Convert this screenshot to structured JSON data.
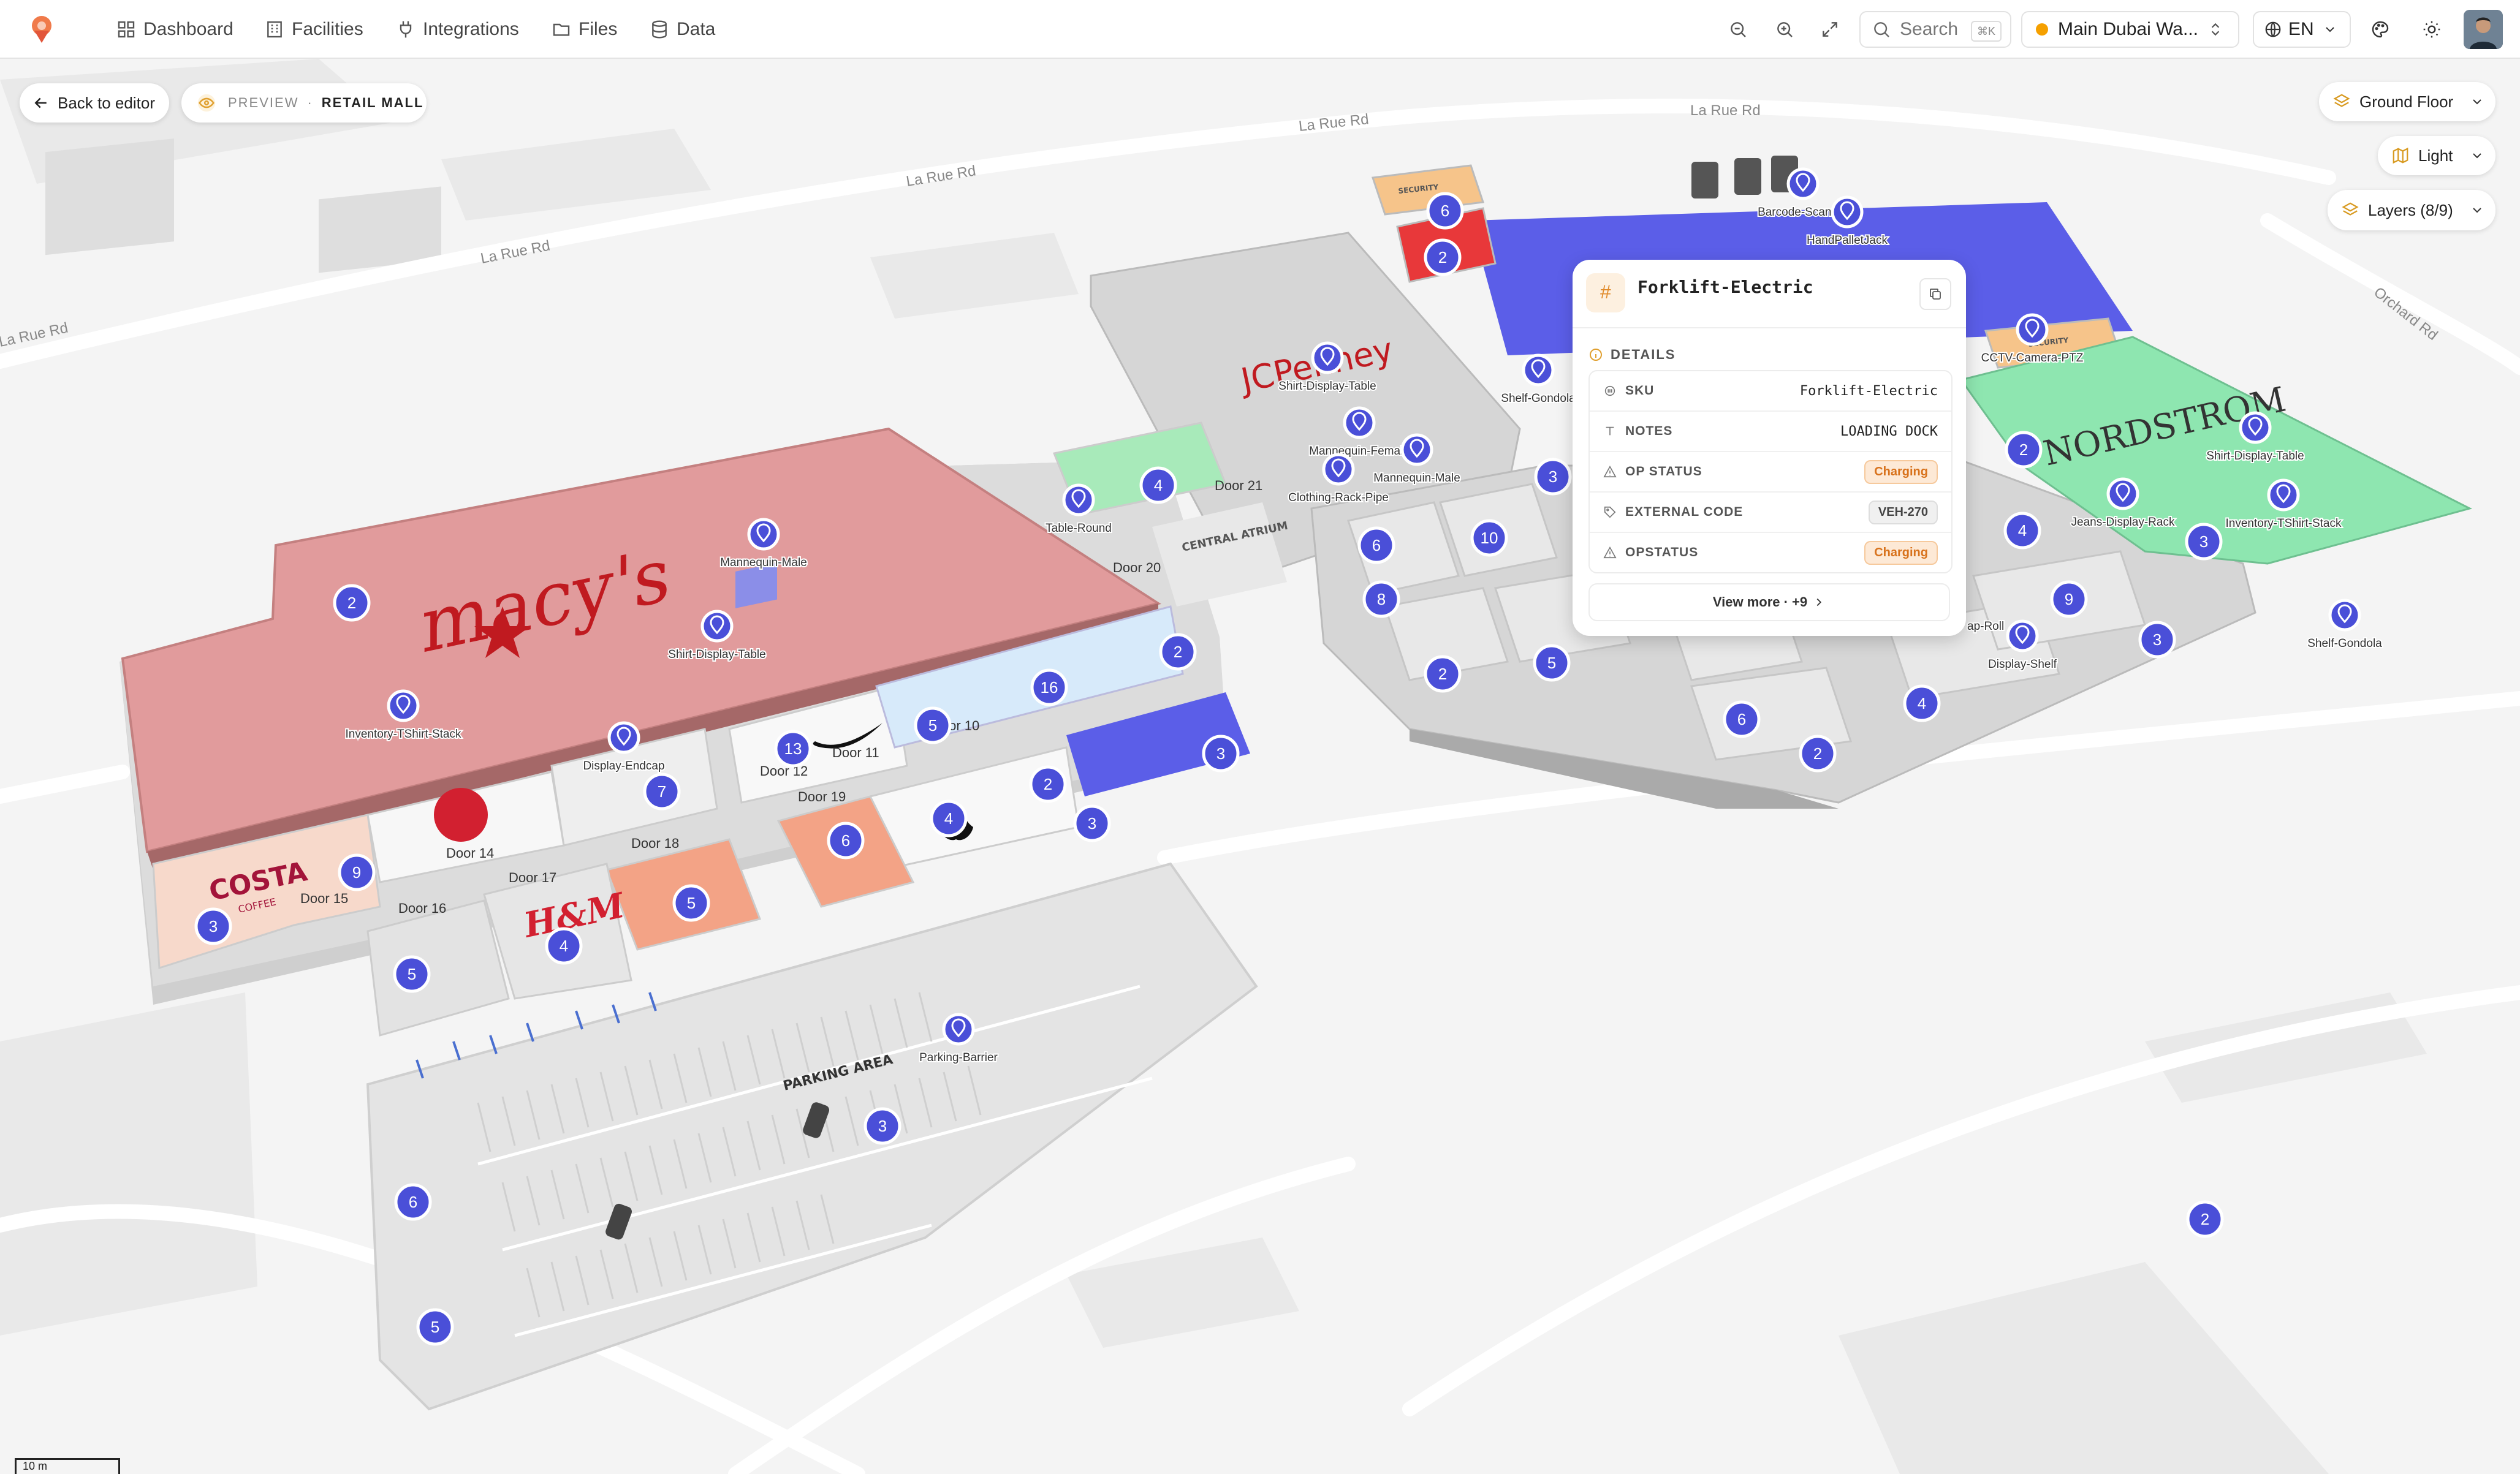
{
  "topbar": {
    "nav": [
      {
        "label": "Dashboard",
        "icon": "grid-icon"
      },
      {
        "label": "Facilities",
        "icon": "building-icon"
      },
      {
        "label": "Integrations",
        "icon": "plug-icon"
      },
      {
        "label": "Files",
        "icon": "folder-icon"
      },
      {
        "label": "Data",
        "icon": "database-icon"
      }
    ],
    "search_label": "Search",
    "search_shortcut": "⌘K",
    "facility": "Main Dubai Wa...",
    "language": "EN"
  },
  "toolbar": {
    "back_label": "Back to editor",
    "preview_label": "PREVIEW",
    "separator": "·",
    "mode_label": "RETAIL MALL",
    "floor": "Ground Floor",
    "theme": "Light",
    "layers": "Layers (8/9)"
  },
  "map": {
    "roads": [
      "La Rue Rd",
      "La Rue Rd",
      "La Rue Rd",
      "La Rue Rd",
      "La Rue Rd",
      "Orchard Rd"
    ],
    "stores": [
      "macy's",
      "JCPenney",
      "NORDSTROM",
      "COSTA",
      "COFFEE",
      "H&M",
      "SECURITY",
      "SECURITY",
      "CENTRAL ATRIUM",
      "PARKING AREA"
    ],
    "markers": [
      "Mannequin-Male",
      "Shirt-Display-Table",
      "Inventory-TShirt-Stack",
      "Display-Endcap",
      "Table-Round",
      "Shirt-Display-Table",
      "Mannequin-Female",
      "Mannequin-Male",
      "Clothing-Rack-Pipe",
      "Shelf-Gondola",
      "Barcode-Scanner",
      "HandPalletJack",
      "CCTV-Camera-PTZ",
      "Shirt-Display-Table",
      "Jeans-Display-Rack",
      "Inventory-TShirt-Stack",
      "Display-Shelf",
      "Shelf-Gondola",
      "Parking-Barrier"
    ],
    "doors": [
      "Door 21",
      "Door 20",
      "Door 11",
      "Door 12",
      "Door 10",
      "Door 19",
      "Door 18",
      "Door 14",
      "Door 17",
      "Door 16",
      "Door 15"
    ],
    "clusters": [
      "2",
      "6",
      "2",
      "2",
      "4",
      "16",
      "5",
      "13",
      "7",
      "2",
      "3",
      "3",
      "9",
      "3",
      "5",
      "4",
      "5",
      "6",
      "4",
      "3",
      "6",
      "5",
      "3",
      "10",
      "6",
      "8",
      "2",
      "5",
      "6",
      "2",
      "4",
      "2",
      "4",
      "9",
      "2",
      "3",
      "3"
    ],
    "partial_labels": [
      "ap-Roll"
    ],
    "scale": "10 m"
  },
  "popup": {
    "title": "Forklift-Electric",
    "section": "DETAILS",
    "rows": [
      {
        "key": "SKU",
        "value": "Forklift-Electric",
        "type": "text"
      },
      {
        "key": "NOTES",
        "value": "LOADING DOCK",
        "type": "text"
      },
      {
        "key": "OP STATUS",
        "value": "Charging",
        "type": "badge-orange"
      },
      {
        "key": "EXTERNAL CODE",
        "value": "VEH-270",
        "type": "badge-gray"
      },
      {
        "key": "OPSTATUS",
        "value": "Charging",
        "type": "badge-orange"
      }
    ],
    "view_more": "View more · +9"
  },
  "colors": {
    "accent_marker": "#4a4fd8",
    "macys": "#e19b9c",
    "nordstrom": "#8ee6b0",
    "jcp_blue": "#5b5ee8",
    "charging": "#d8721c"
  }
}
